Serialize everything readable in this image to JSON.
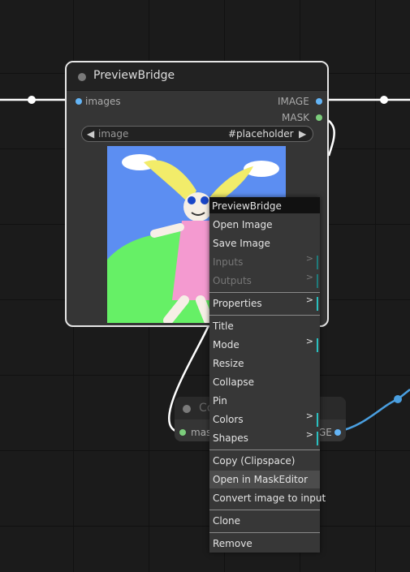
{
  "node": {
    "title": "PreviewBridge",
    "input_label": "images",
    "outputs": [
      "IMAGE",
      "MASK"
    ],
    "widget": {
      "name": "image",
      "value": "#placeholder",
      "left_arrow": "◀",
      "right_arrow": "▶"
    }
  },
  "node2": {
    "title_partial": "Co",
    "input_partial": "mas",
    "output_partial": "GE"
  },
  "context_menu": {
    "title": "PreviewBridge",
    "items": [
      {
        "label": "Open Image",
        "disabled": false,
        "submenu": false
      },
      {
        "label": "Save Image",
        "disabled": false,
        "submenu": false
      },
      {
        "label": "Inputs",
        "disabled": true,
        "submenu": true
      },
      {
        "label": "Outputs",
        "disabled": true,
        "submenu": true
      },
      {
        "label": "Properties",
        "disabled": false,
        "submenu": true
      },
      {
        "label": "Title",
        "disabled": false,
        "submenu": false
      },
      {
        "label": "Mode",
        "disabled": false,
        "submenu": true
      },
      {
        "label": "Resize",
        "disabled": false,
        "submenu": false
      },
      {
        "label": "Collapse",
        "disabled": false,
        "submenu": false
      },
      {
        "label": "Pin",
        "disabled": false,
        "submenu": false
      },
      {
        "label": "Colors",
        "disabled": false,
        "submenu": true
      },
      {
        "label": "Shapes",
        "disabled": false,
        "submenu": true
      },
      {
        "label": "Copy (Clipspace)",
        "disabled": false,
        "submenu": false
      },
      {
        "label": "Open in MaskEditor",
        "disabled": false,
        "submenu": false,
        "hovered": true
      },
      {
        "label": "Convert image to input",
        "disabled": false,
        "submenu": false
      },
      {
        "label": "Clone",
        "disabled": false,
        "submenu": false
      },
      {
        "label": "Remove",
        "disabled": false,
        "submenu": false
      }
    ],
    "submenu_arrow": ">"
  },
  "colors": {
    "image_slot": "#64b5f6",
    "mask_slot": "#7ccd7c",
    "menu_accent": "#2ac0c0",
    "selection_link": "#4a9fe0"
  }
}
